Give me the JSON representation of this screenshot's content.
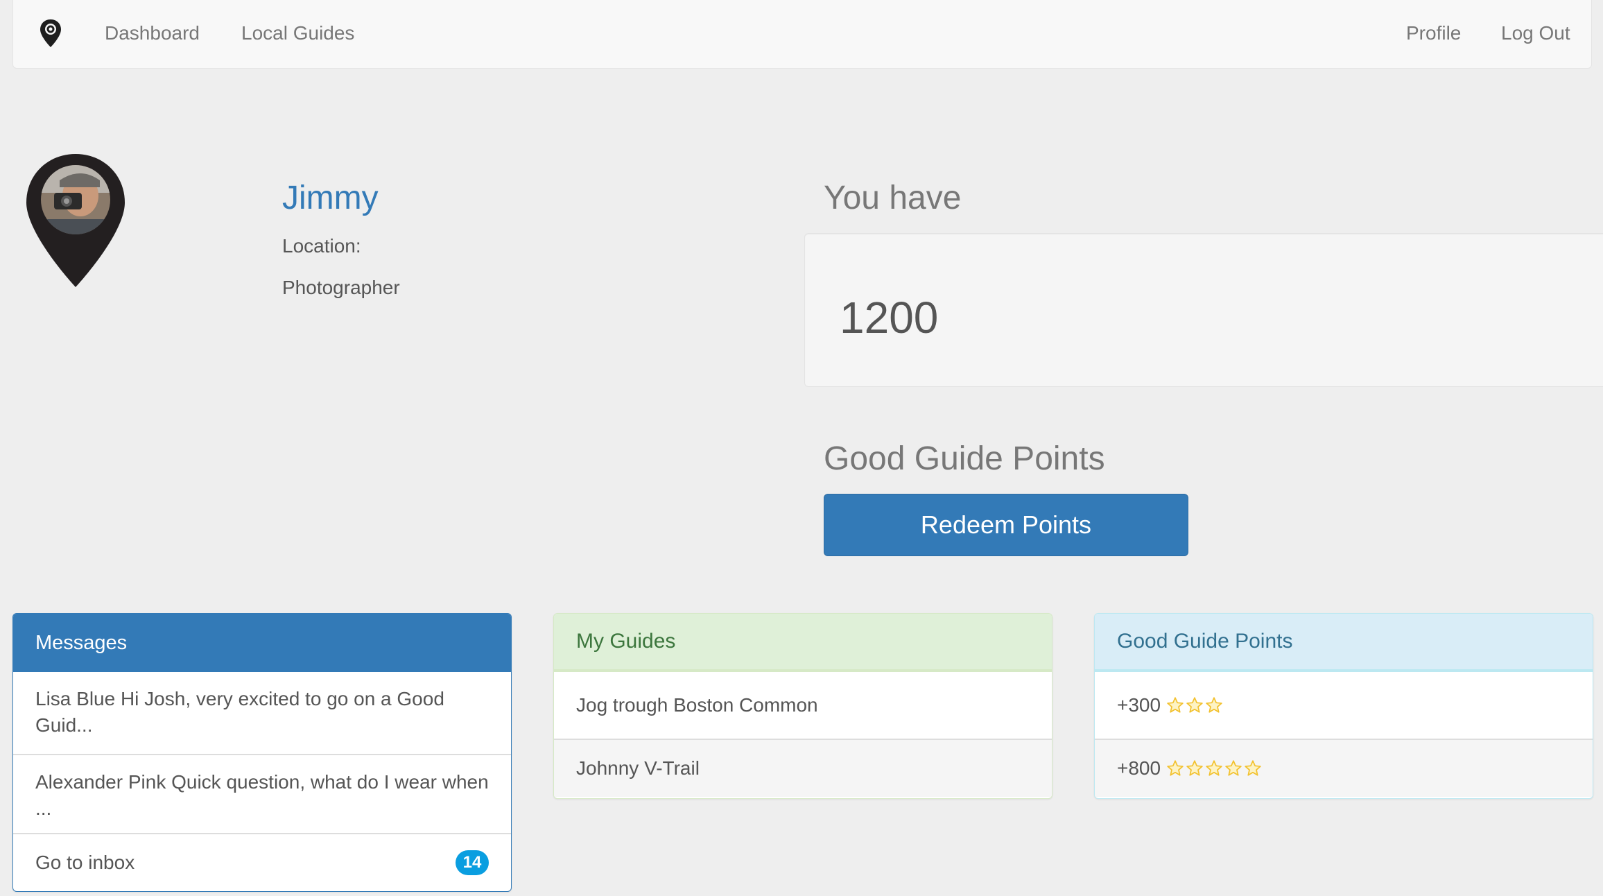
{
  "nav": {
    "dashboard_label": "Dashboard",
    "guides_label": "Local Guides",
    "profile_label": "Profile",
    "logout_label": "Log Out",
    "logo_icon": "map-pin-logo-icon"
  },
  "profile": {
    "name": "Jimmy",
    "location_label": "Location:",
    "role": "Photographer",
    "avatar_icon": "map-pin-avatar-icon"
  },
  "points": {
    "you_have_label": "You have",
    "value": "1200",
    "section_title": "Good Guide Points",
    "redeem_label": "Redeem Points"
  },
  "messages_panel": {
    "title": "Messages",
    "items": [
      {
        "text": "Lisa Blue Hi Josh, very excited to go on a Good Guid..."
      },
      {
        "text": "Alexander Pink Quick question, what do I wear when ..."
      }
    ],
    "inbox_label": "Go to inbox",
    "inbox_count": "14"
  },
  "guides_panel": {
    "title": "My Guides",
    "items": [
      {
        "text": "Jog trough Boston Common"
      },
      {
        "text": "Johnny V-Trail"
      }
    ]
  },
  "points_panel": {
    "title": "Good Guide Points",
    "items": [
      {
        "amount": "+300",
        "stars": 3
      },
      {
        "amount": "+800",
        "stars": 5
      }
    ]
  },
  "colors": {
    "primary": "#337ab7",
    "success_bg": "#dff0d8",
    "info_bg": "#d9edf7",
    "badge": "#0a9ee0",
    "star": "#f2c12e"
  }
}
